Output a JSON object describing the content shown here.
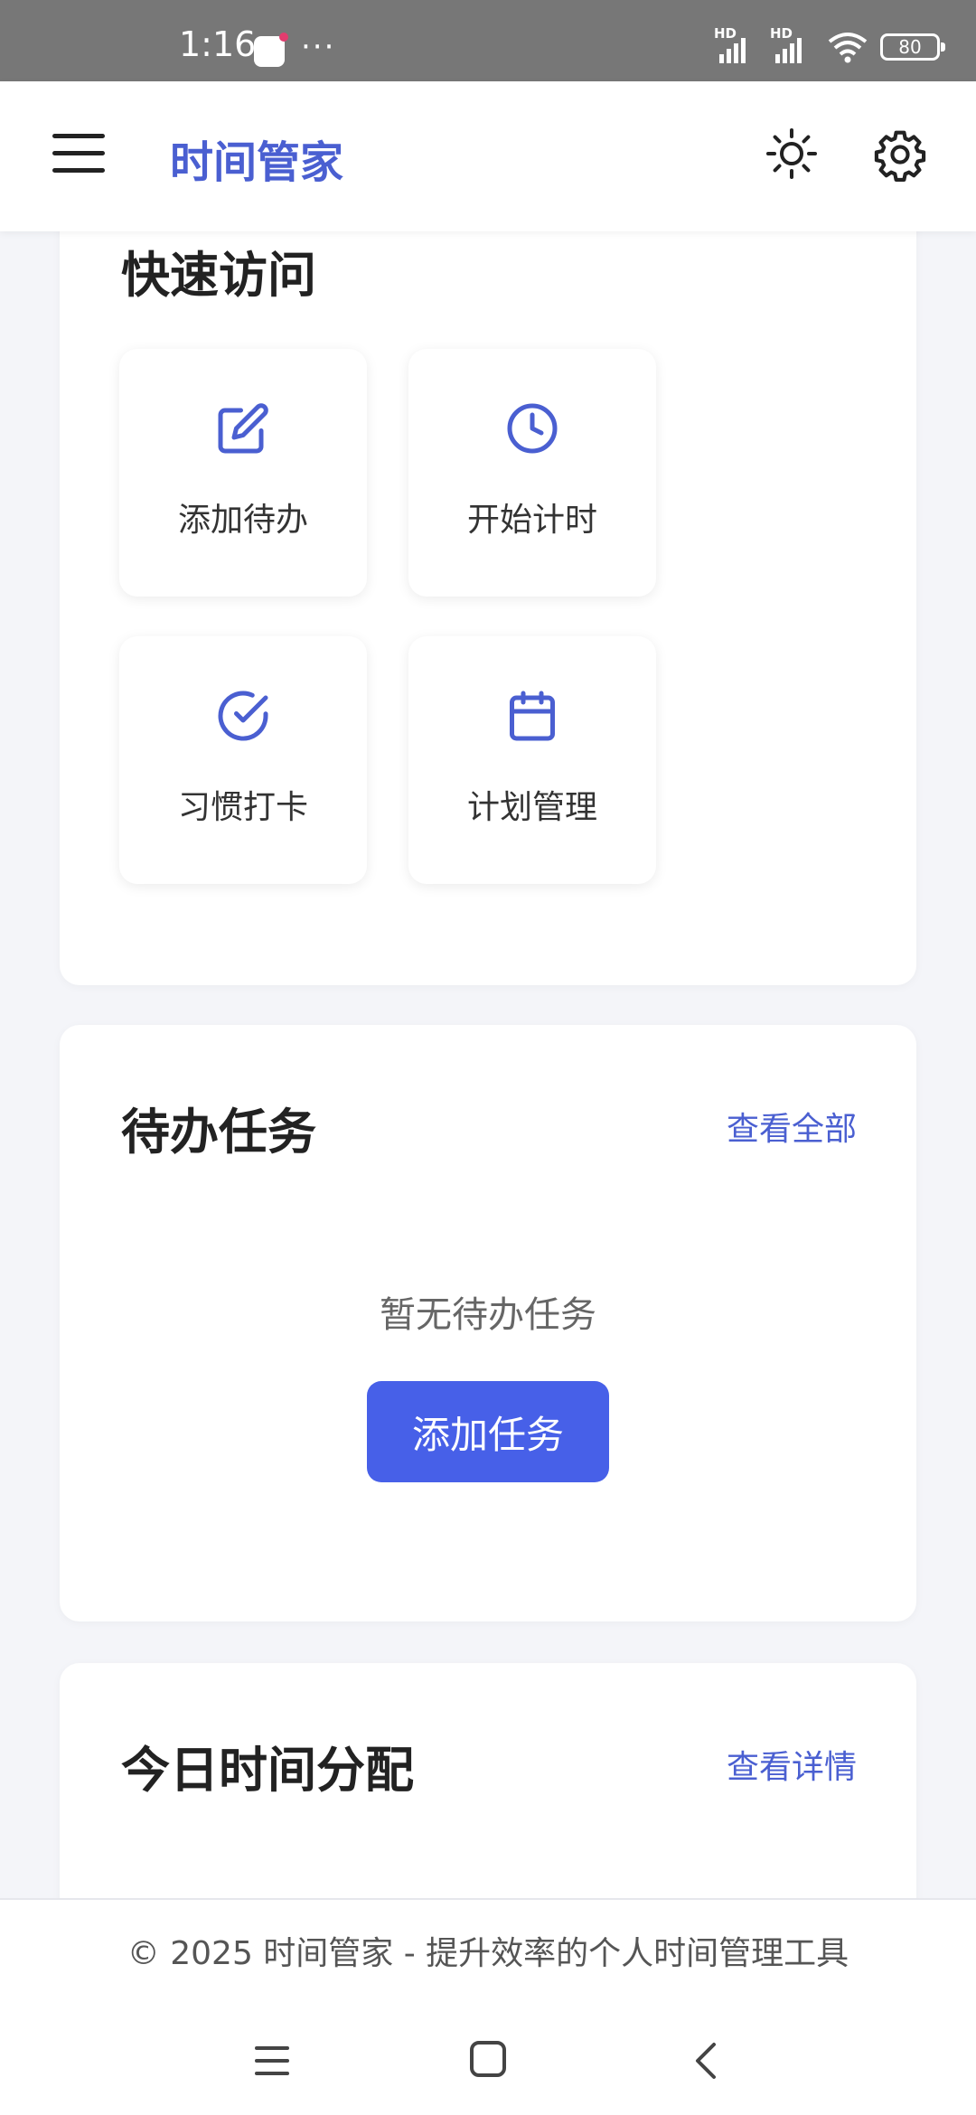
{
  "status_bar": {
    "time": "1:16",
    "more": "···",
    "network_1": "HD",
    "network_2": "HD",
    "battery": "80",
    "icons": [
      "app-notification-icon",
      "signal-icon",
      "signal-icon",
      "wifi-icon",
      "battery-icon"
    ]
  },
  "app_bar": {
    "title": "时间管家",
    "icons": [
      "menu-icon",
      "sun-icon",
      "gear-icon"
    ],
    "accent_color": "#4a5fd1"
  },
  "quick_access": {
    "title": "快速访问",
    "items": [
      {
        "label": "添加待办",
        "icon": "edit-icon"
      },
      {
        "label": "开始计时",
        "icon": "clock-icon"
      },
      {
        "label": "习惯打卡",
        "icon": "check-circle-icon"
      },
      {
        "label": "计划管理",
        "icon": "calendar-icon"
      }
    ]
  },
  "todo": {
    "title": "待办任务",
    "link": "查看全部",
    "empty_text": "暂无待办任务",
    "add_button": "添加任务",
    "button_color": "#4760e8"
  },
  "time_distribution": {
    "title": "今日时间分配",
    "link": "查看详情"
  },
  "footer": {
    "text": "© 2025 时间管家 - 提升效率的个人时间管理工具"
  },
  "nav_bar": {
    "icons": [
      "recent-apps-icon",
      "home-icon",
      "back-icon"
    ]
  }
}
